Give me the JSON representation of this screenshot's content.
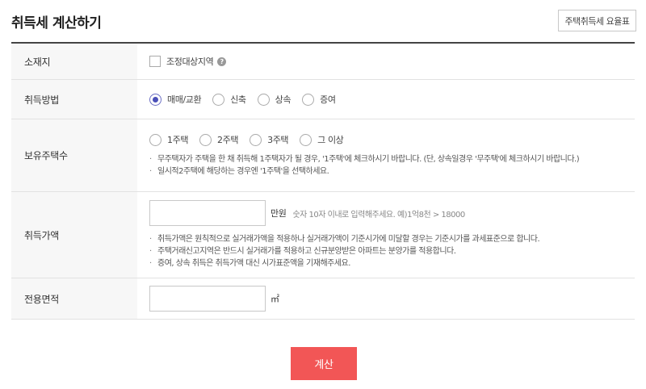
{
  "header": {
    "title": "취득세 계산하기",
    "table_button_label": "주택취득세 요율표"
  },
  "location": {
    "label": "소재지",
    "checkbox_label": "조정대상지역",
    "help_glyph": "?"
  },
  "acquisition_method": {
    "label": "취득방법",
    "options": [
      "매매/교환",
      "신축",
      "상속",
      "증여"
    ],
    "selected": "매매/교환"
  },
  "houses_owned": {
    "label": "보유주택수",
    "options": [
      "1주택",
      "2주택",
      "3주택",
      "그 이상"
    ],
    "notes": [
      "무주택자가 주택을 한 채 취득해 1주택자가 될 경우, '1주택'에 체크하시기 바랍니다. (단, 상속일경우 '무주택'에 체크하시기 바랍니다.)",
      "일시적2주택에 해당하는 경우엔 '1주택'을 선택하세요."
    ]
  },
  "price": {
    "label": "취득가액",
    "value": "",
    "unit": "만원",
    "hint": "숫자 10자 이내로 입력해주세요. 예)1억8천 > 18000",
    "notes": [
      "취득가액은 원칙적으로 실거래가액을 적용하나 실거래가액이 기준시가에 미달할 경우는 기준시가를 과세표준으로 합니다.",
      "주택거래신고지역은 반드시 실거래가를 적용하고 신규분양받은 아파트는 분양가를 적용합니다.",
      "증여, 상속 취득은 취득가액 대신 시가표준액을 기재해주세요."
    ]
  },
  "area": {
    "label": "전용면적",
    "value": "",
    "unit": "㎡"
  },
  "calculate_button_label": "계산",
  "colors": {
    "accent": "#f25656",
    "radio_selected": "#4a4fb8",
    "label_bg": "#f7f7f7"
  }
}
